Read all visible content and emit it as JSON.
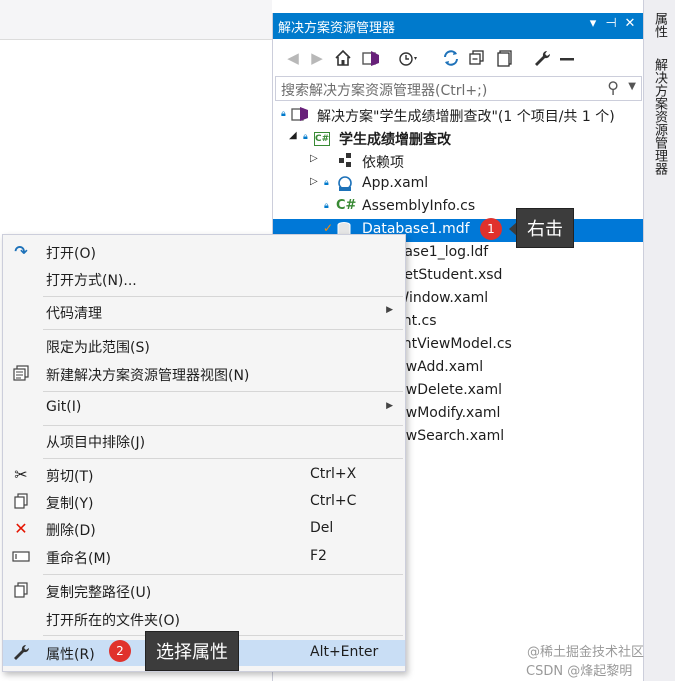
{
  "solution_explorer": {
    "title": "解决方案资源管理器",
    "title_buttons": [
      "▾",
      "⊣",
      "✕"
    ],
    "search_placeholder": "搜索解决方案资源管理器(Ctrl+;)",
    "tree": [
      {
        "label": "解决方案\"学生成绩增删查改\"(1 个项目/共 1 个)",
        "kind": "solution"
      },
      {
        "label": "学生成绩增删查改",
        "kind": "project",
        "bold": true
      },
      {
        "label": "依赖项",
        "kind": "dependencies"
      },
      {
        "label": "App.xaml",
        "kind": "xaml"
      },
      {
        "label": "AssemblyInfo.cs",
        "kind": "cs"
      },
      {
        "label": "Database1.mdf",
        "kind": "database",
        "selected": true
      },
      {
        "label": "Database1_log.ldf",
        "kind": "file"
      },
      {
        "label": "DataSetStudent.xsd",
        "kind": "file"
      },
      {
        "label": "MainWindow.xaml",
        "kind": "xaml"
      },
      {
        "label": "Student.cs",
        "kind": "cs"
      },
      {
        "label": "StudentViewModel.cs",
        "kind": "cs"
      },
      {
        "label": "WindowAdd.xaml",
        "kind": "xaml"
      },
      {
        "label": "WindowDelete.xaml",
        "kind": "xaml"
      },
      {
        "label": "WindowModify.xaml",
        "kind": "xaml"
      },
      {
        "label": "WindowSearch.xaml",
        "kind": "xaml"
      }
    ]
  },
  "side_tabs": [
    "属性",
    "解决方案资源管理器"
  ],
  "annotations": {
    "step1_number": "1",
    "step1_text": "右击",
    "step2_number": "2",
    "step2_text": "选择属性"
  },
  "context_menu": {
    "items": [
      {
        "label": "打开(O)",
        "icon": "open-icon"
      },
      {
        "label": "打开方式(N)..."
      },
      {
        "label": "代码清理",
        "submenu": true
      },
      {
        "label": "限定为此范围(S)"
      },
      {
        "label": "新建解决方案资源管理器视图(N)",
        "icon": "new-view-icon"
      },
      {
        "label": "Git(I)",
        "submenu": true
      },
      {
        "label": "从项目中排除(J)"
      },
      {
        "label": "剪切(T)",
        "shortcut": "Ctrl+X",
        "icon": "cut-icon"
      },
      {
        "label": "复制(Y)",
        "shortcut": "Ctrl+C",
        "icon": "copy-icon"
      },
      {
        "label": "删除(D)",
        "shortcut": "Del",
        "icon": "delete-icon"
      },
      {
        "label": "重命名(M)",
        "shortcut": "F2",
        "icon": "rename-icon"
      },
      {
        "label": "复制完整路径(U)",
        "icon": "copy-path-icon"
      },
      {
        "label": "打开所在的文件夹(O)"
      },
      {
        "label": "属性(R)",
        "shortcut": "Alt+Enter",
        "icon": "wrench-icon",
        "highlighted": true
      }
    ]
  },
  "watermark": {
    "line1": "@稀土掘金技术社区",
    "line2": "CSDN @烽起黎明"
  },
  "colors": {
    "accent": "#007acc",
    "selection": "#0078d7",
    "menu_highlight": "#c9def5",
    "badge": "#e0312c",
    "callout": "#3c3c3c"
  }
}
